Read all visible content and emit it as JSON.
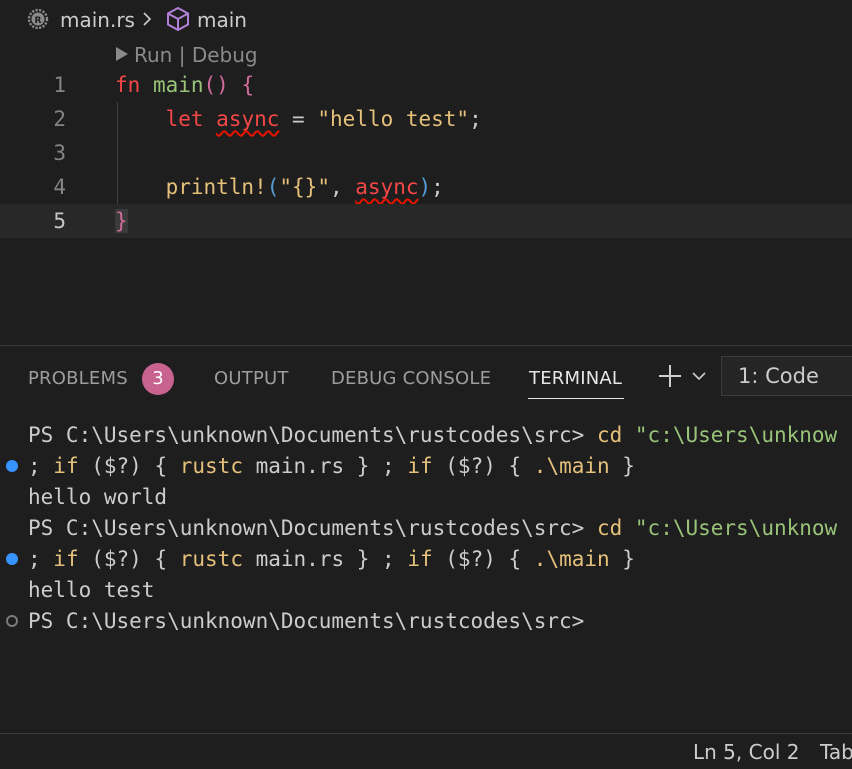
{
  "breadcrumb": {
    "file": "main.rs",
    "symbol": "main"
  },
  "codelens": {
    "run": "Run",
    "separator": " | ",
    "debug": "Debug"
  },
  "editor": {
    "current_line": 5,
    "lines": [
      {
        "number": "1",
        "text": "fn main() {"
      },
      {
        "number": "2",
        "text": "    let async = \"hello test\";"
      },
      {
        "number": "3",
        "text": ""
      },
      {
        "number": "4",
        "text": "    println!(\"{}\", async);"
      },
      {
        "number": "5",
        "text": "}"
      }
    ]
  },
  "panel": {
    "tabs": [
      {
        "label": "PROBLEMS",
        "active": false
      },
      {
        "label": "OUTPUT",
        "active": false
      },
      {
        "label": "DEBUG CONSOLE",
        "active": false
      },
      {
        "label": "TERMINAL",
        "active": true
      }
    ],
    "problems_count": "3",
    "terminal_select": "1: Code"
  },
  "terminal": {
    "prompt": "PS C:\\Users\\unknown\\Documents\\rustcodes\\src>",
    "cmd_cd": "cd",
    "cd_arg": "\"c:\\Users\\unknow",
    "line2_parts": [
      "; ",
      "if",
      " ($?) { ",
      "rustc",
      " main.rs } ; ",
      "if",
      " ($?) { ",
      ".\\main",
      " }"
    ],
    "output1": "hello world",
    "output2": "hello test"
  },
  "status": {
    "position": "Ln 5, Col 2",
    "tab_size": "Tab"
  }
}
